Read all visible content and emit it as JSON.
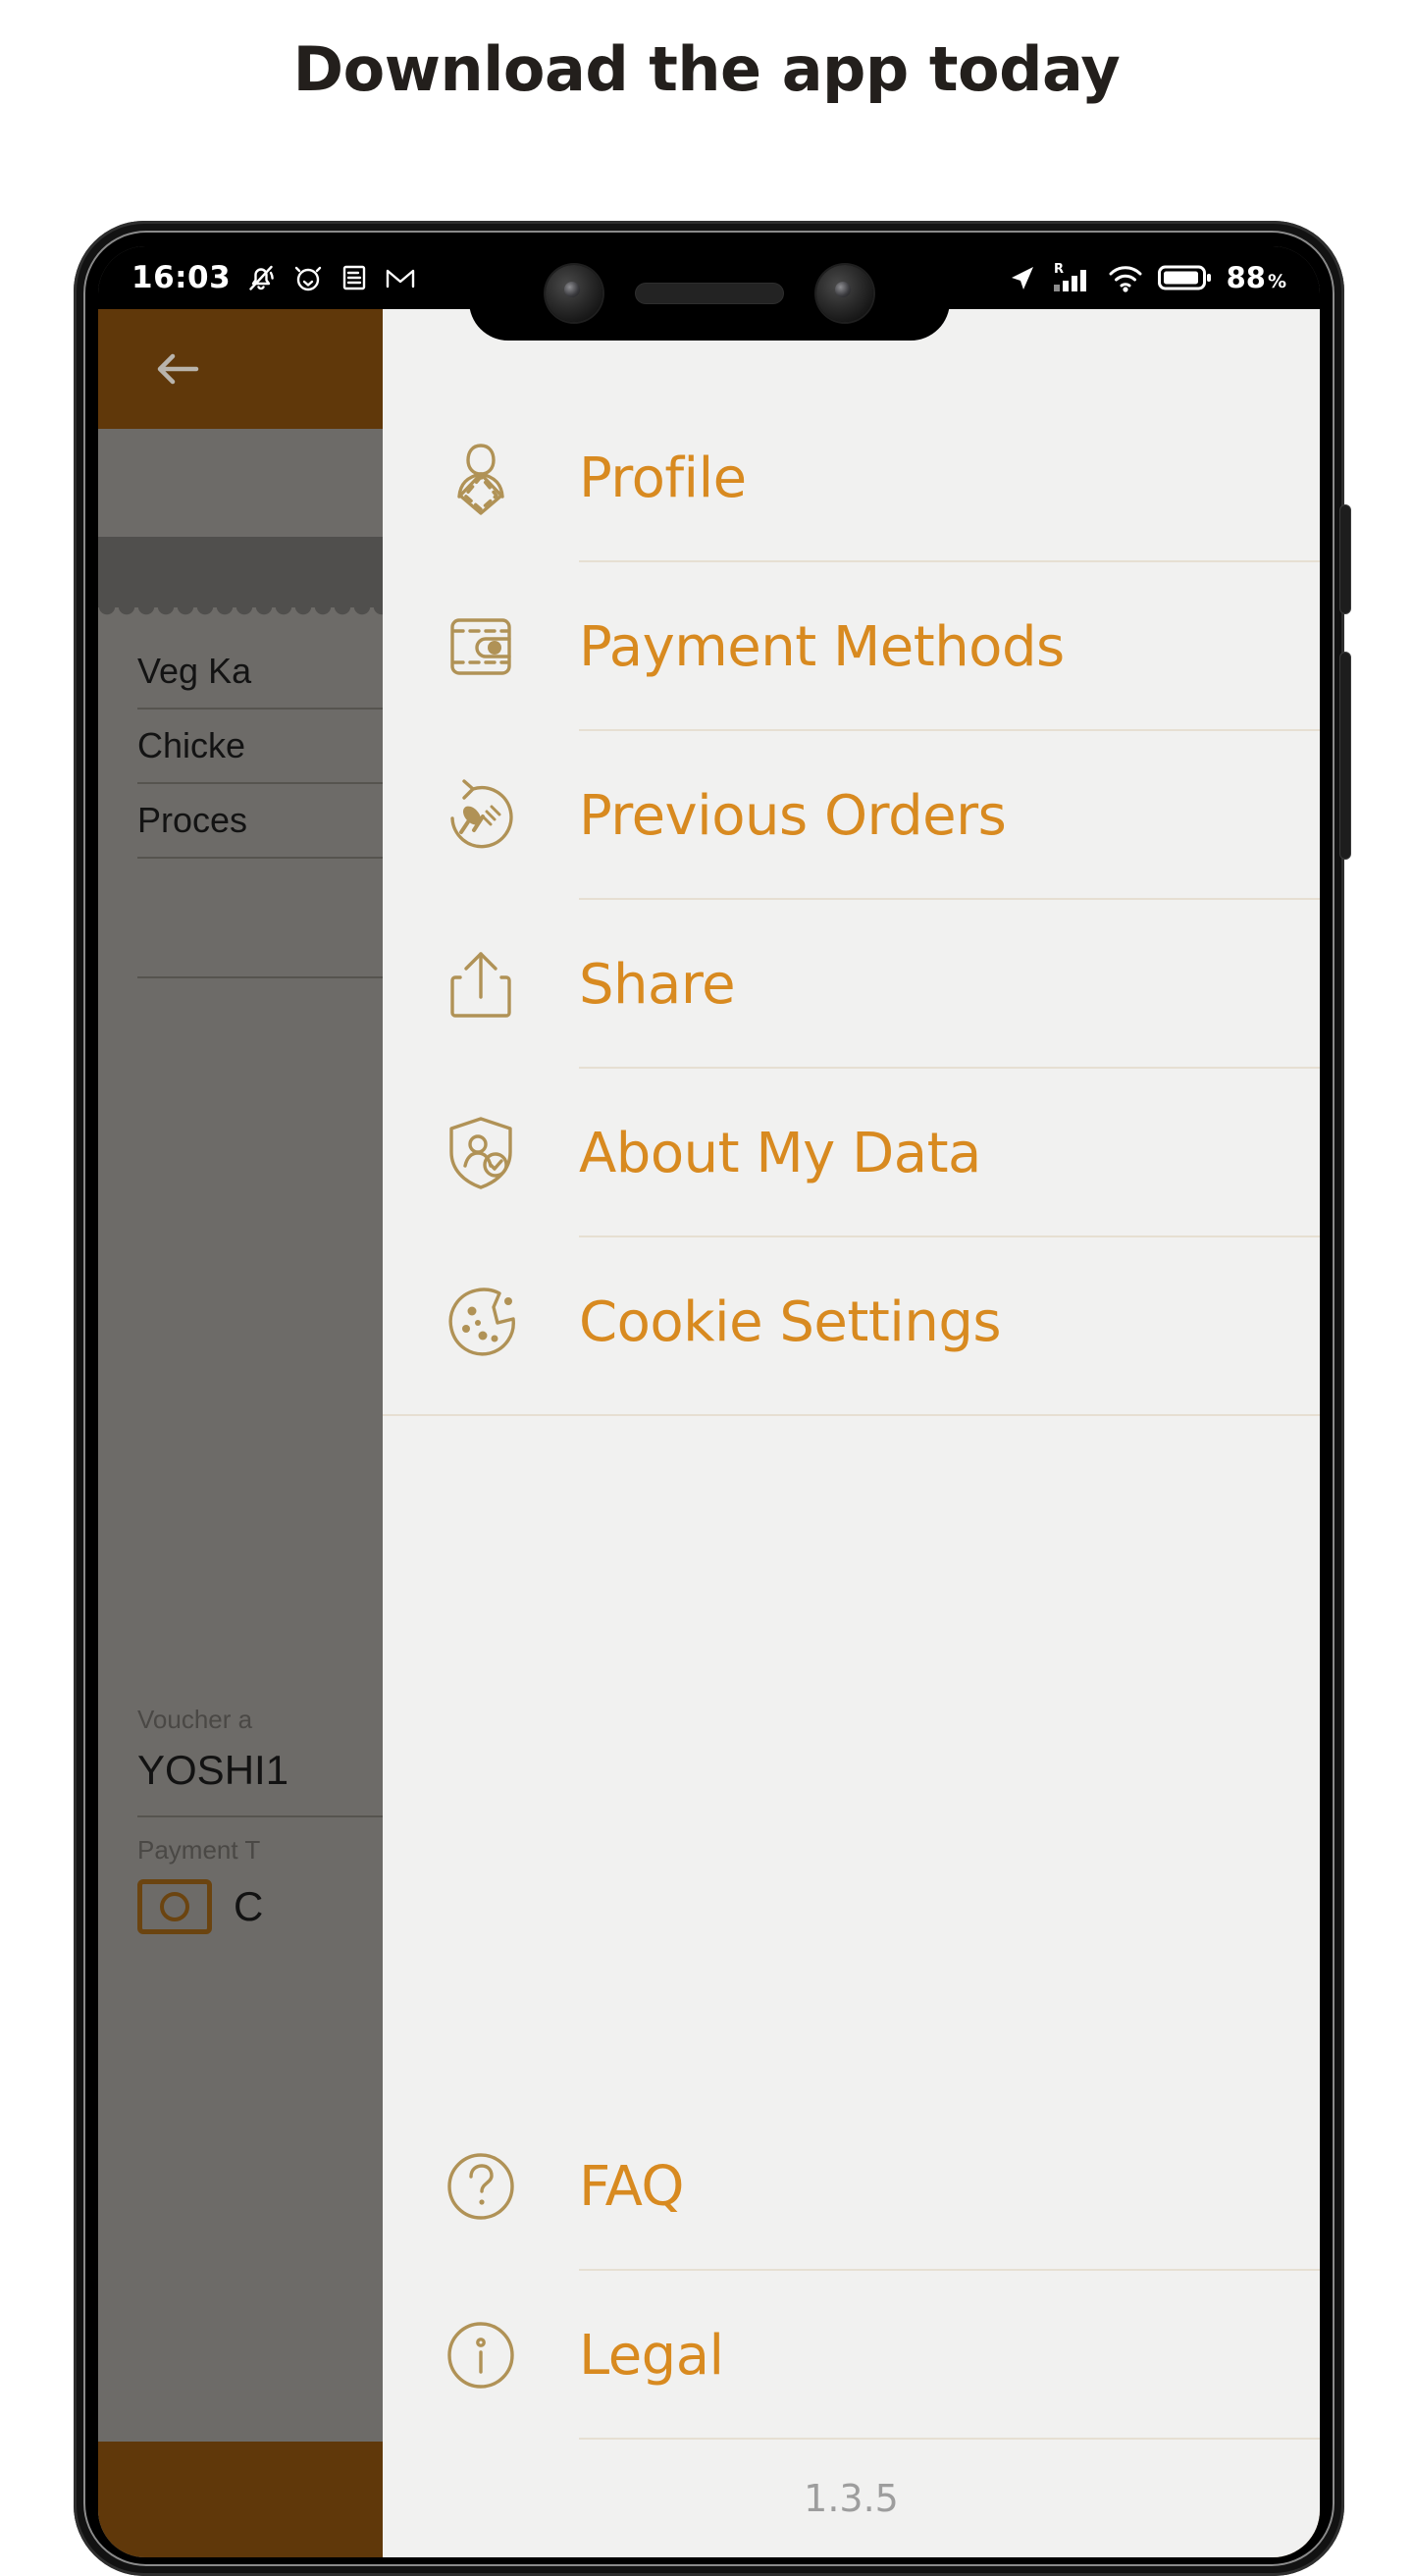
{
  "headline": "Download the app today",
  "colors": {
    "accent": "#d88a20",
    "icon_stroke": "#b09256",
    "brand_brown": "#60380a",
    "drawer_bg": "#f1f1f0",
    "divider": "#e6dfd2"
  },
  "status_bar": {
    "time": "16:03",
    "left_icons": [
      "bell-mute-icon",
      "alarm-clock-icon",
      "document-icon",
      "gmail-icon"
    ],
    "right_icons": [
      "location-arrow-icon",
      "roaming-signal-icon",
      "wifi-icon",
      "battery-icon"
    ],
    "roaming_label": "R",
    "battery_level": "88",
    "battery_unit": "%"
  },
  "notch": {
    "left_camera": "front-camera-icon",
    "speaker": "earpiece-speaker",
    "right_camera": "front-camera-secondary-icon"
  },
  "background_app": {
    "back_button": "back-arrow-icon",
    "rows": [
      "Veg Ka",
      "Chicke",
      "Proces"
    ],
    "voucher_label": "Voucher a",
    "voucher_code": "YOSHI1",
    "payment_label": "Payment T",
    "payment_value": "C",
    "payment_icon": "cash-banknote-icon"
  },
  "drawer": {
    "items": [
      {
        "label": "Profile",
        "icon": "profile-icon"
      },
      {
        "label": "Payment Methods",
        "icon": "wallet-icon"
      },
      {
        "label": "Previous Orders",
        "icon": "order-history-icon"
      },
      {
        "label": "Share",
        "icon": "share-icon"
      },
      {
        "label": "About My Data",
        "icon": "shield-user-icon"
      },
      {
        "label": "Cookie Settings",
        "icon": "cookie-icon"
      }
    ],
    "footer_items": [
      {
        "label": "FAQ",
        "icon": "question-circle-icon"
      },
      {
        "label": "Legal",
        "icon": "info-circle-icon"
      }
    ],
    "version": "1.3.5"
  }
}
